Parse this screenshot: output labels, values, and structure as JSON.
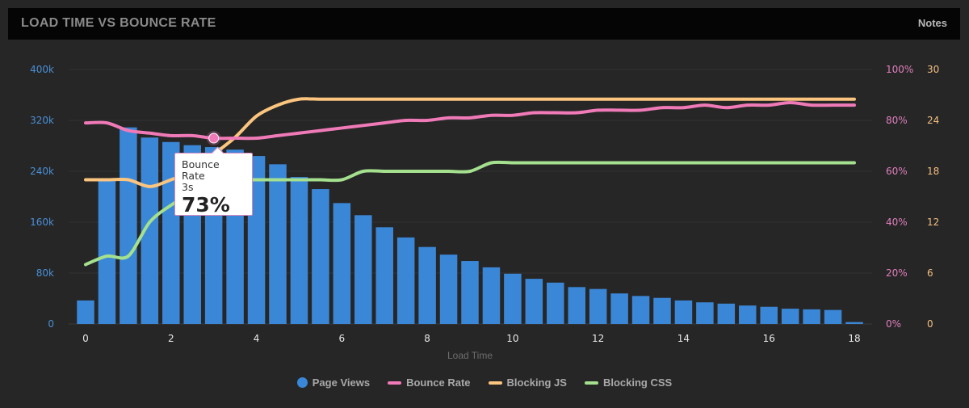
{
  "header": {
    "title": "LOAD TIME VS BOUNCE RATE",
    "notes_label": "Notes"
  },
  "tooltip": {
    "series": "Bounce Rate",
    "x": "3s",
    "value": "73%"
  },
  "legend": [
    {
      "label": "Page Views",
      "color": "#3a87d8",
      "shape": "dot"
    },
    {
      "label": "Bounce Rate",
      "color": "#f07ab8",
      "shape": "line"
    },
    {
      "label": "Blocking JS",
      "color": "#fbc57f",
      "shape": "line"
    },
    {
      "label": "Blocking CSS",
      "color": "#a4e08e",
      "shape": "line"
    }
  ],
  "chart_data": {
    "type": "bar+line",
    "title": "LOAD TIME VS BOUNCE RATE",
    "xlabel": "Load Time",
    "x_ticks": [
      "0",
      "2",
      "4",
      "6",
      "8",
      "10",
      "12",
      "14",
      "16",
      "18"
    ],
    "x": [
      0,
      0.5,
      1,
      1.5,
      2,
      2.5,
      3,
      3.5,
      4,
      4.5,
      5,
      5.5,
      6,
      6.5,
      7,
      7.5,
      8,
      8.5,
      9,
      9.5,
      10,
      10.5,
      11,
      11.5,
      12,
      12.5,
      13,
      13.5,
      14,
      14.5,
      15,
      15.5,
      16,
      16.5,
      17,
      17.5,
      18
    ],
    "xlim": [
      0,
      18
    ],
    "axes": {
      "left": {
        "ticks": [
          "0",
          "80k",
          "160k",
          "240k",
          "320k",
          "400k"
        ],
        "range": [
          0,
          400000
        ],
        "color": "#4a8fd6"
      },
      "right_percent": {
        "ticks": [
          "0%",
          "20%",
          "40%",
          "60%",
          "80%",
          "100%"
        ],
        "range": [
          0,
          100
        ],
        "color": "#e07fbd"
      },
      "right_js": {
        "ticks": [
          "0",
          "6",
          "12",
          "18",
          "24",
          "30"
        ],
        "range": [
          0,
          30
        ],
        "color": "#f2be80"
      }
    },
    "grid": true,
    "legend_position": "bottom",
    "series": [
      {
        "name": "Page Views",
        "type": "bar",
        "axis": "left",
        "color": "#3a87d8",
        "values": [
          37000,
          227000,
          309000,
          293000,
          286000,
          281000,
          278000,
          274000,
          264000,
          251000,
          231000,
          212000,
          190000,
          171000,
          152000,
          136000,
          121000,
          109000,
          99000,
          89000,
          79000,
          71000,
          65000,
          58000,
          55000,
          48000,
          44000,
          41000,
          37000,
          34000,
          32000,
          29000,
          27000,
          24000,
          23000,
          22000,
          3000
        ]
      },
      {
        "name": "Bounce Rate",
        "type": "line",
        "axis": "right_percent",
        "color": "#f07ab8",
        "values": [
          79,
          79,
          76,
          75,
          74,
          74,
          73,
          73,
          73,
          74,
          75,
          76,
          77,
          78,
          79,
          80,
          80,
          81,
          81,
          82,
          82,
          83,
          83,
          83,
          84,
          84,
          84,
          85,
          85,
          86,
          85,
          86,
          86,
          87,
          86,
          86,
          86
        ]
      },
      {
        "name": "Blocking JS",
        "type": "line",
        "axis": "right_js",
        "color": "#fbc57f",
        "values": [
          17,
          17,
          17,
          16.2,
          17,
          18,
          20,
          22,
          24.5,
          25.8,
          26.5,
          26.5,
          26.5,
          26.5,
          26.5,
          26.5,
          26.5,
          26.5,
          26.5,
          26.5,
          26.5,
          26.5,
          26.5,
          26.5,
          26.5,
          26.5,
          26.5,
          26.5,
          26.5,
          26.5,
          26.5,
          26.5,
          26.5,
          26.5,
          26.5,
          26.5,
          26.5
        ]
      },
      {
        "name": "Blocking CSS",
        "type": "line",
        "axis": "right_js",
        "color": "#a4e08e",
        "values": [
          7,
          8,
          8,
          12,
          14,
          15.5,
          16.5,
          17,
          17,
          17,
          17,
          17,
          17,
          18,
          18,
          18,
          18,
          18,
          18,
          19,
          19,
          19,
          19,
          19,
          19,
          19,
          19,
          19,
          19,
          19,
          19,
          19,
          19,
          19,
          19,
          19,
          19
        ]
      }
    ],
    "highlight": {
      "series": "Bounce Rate",
      "x": 3,
      "value": 73
    }
  }
}
